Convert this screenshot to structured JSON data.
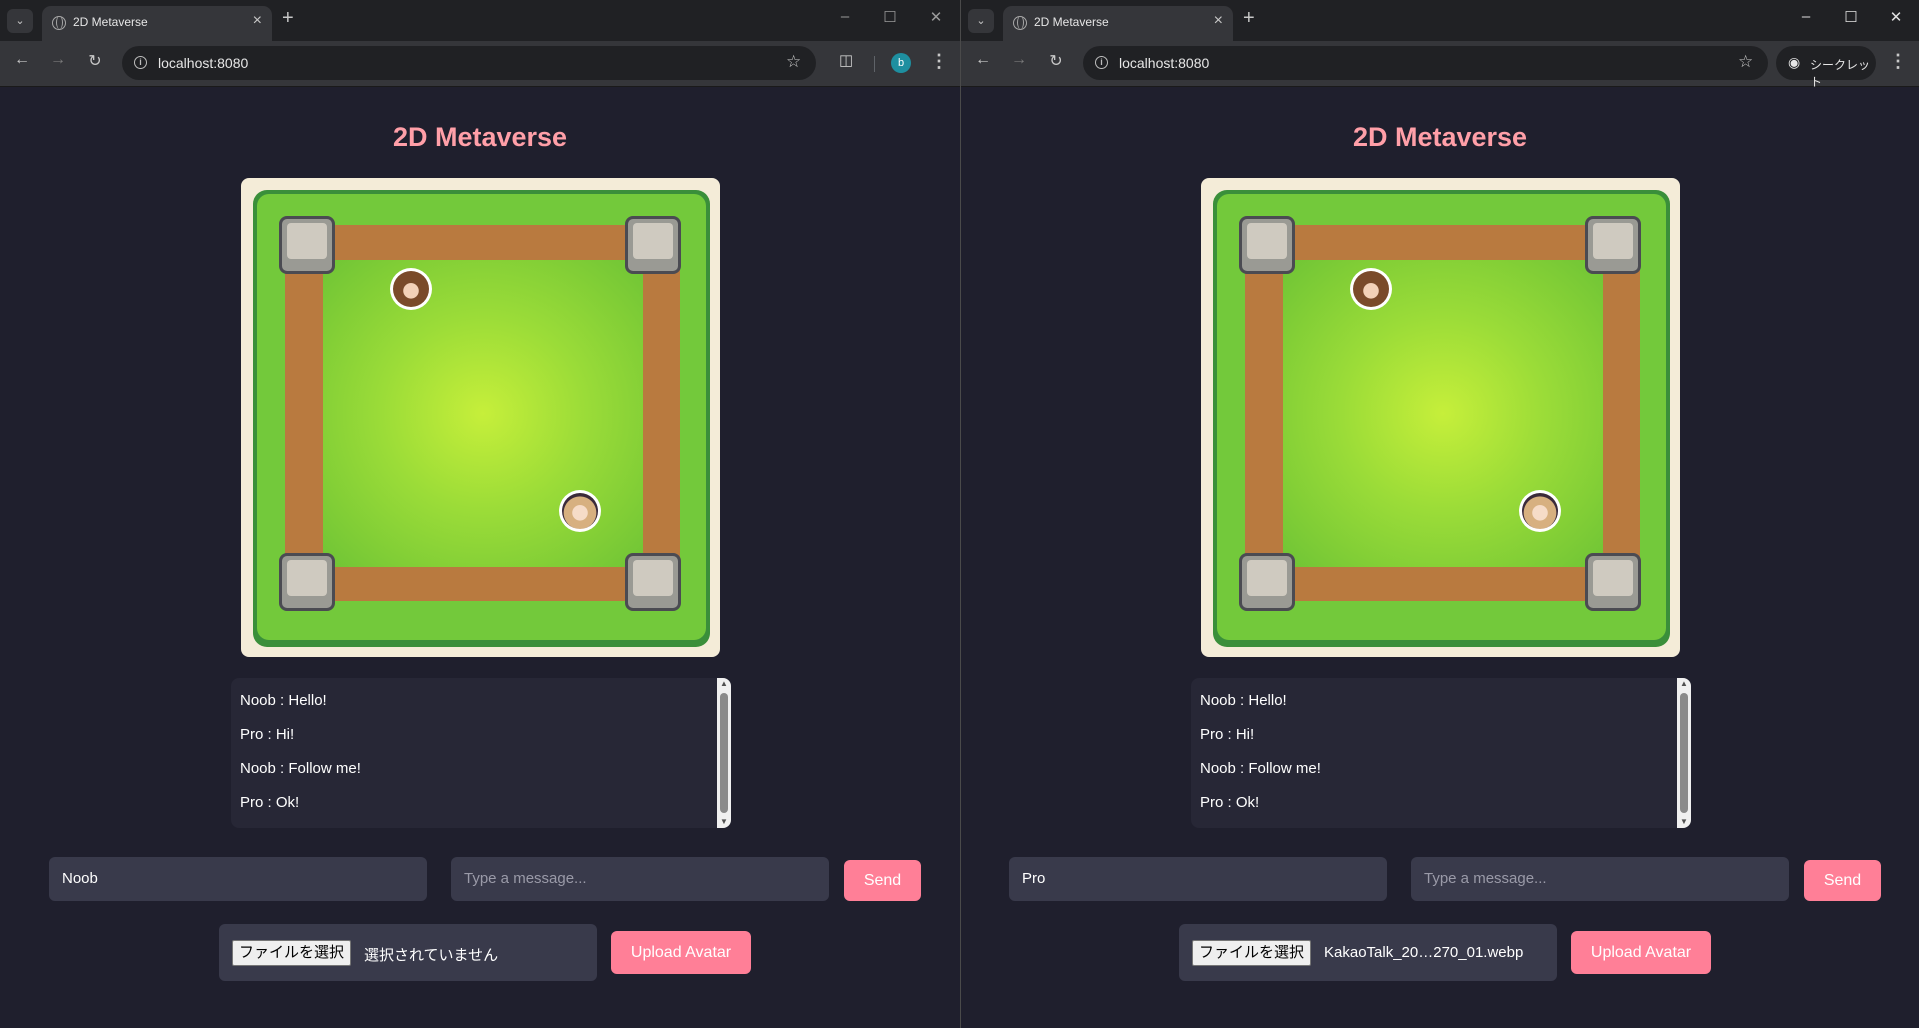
{
  "browser": {
    "tab_title": "2D Metaverse",
    "tab_menu_icon": "chevron-down-icon",
    "new_tab": "+",
    "tab_close": "×",
    "url": "localhost:8080",
    "profile_initial": "b",
    "incognito_label": "シークレット"
  },
  "app": {
    "title": "2D Metaverse",
    "send_label": "Send",
    "upload_label": "Upload Avatar",
    "message_placeholder": "Type a message...",
    "file_button_label": "ファイルを選択",
    "chat_messages": [
      "Noob : Hello!",
      "Pro : Hi!",
      "Noob : Follow me!",
      "Pro : Ok!"
    ]
  },
  "left_window": {
    "username": "Noob",
    "file_status": "選択されていません"
  },
  "right_window": {
    "username": "Pro",
    "file_status": "KakaoTalk_20…270_01.webp"
  },
  "colors": {
    "title": "#ff9fa8",
    "button": "#ff7f97",
    "background": "#1f1f2d"
  }
}
